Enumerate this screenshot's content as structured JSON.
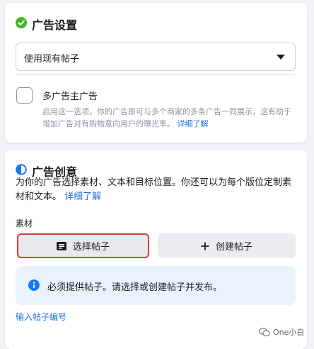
{
  "ad_settings": {
    "title": "广告设置",
    "status_icon": "check-circle-icon",
    "status_color": "#42b72a",
    "dropdown_value": "使用现有帖子",
    "multi_advertiser_label": "多广告主广告",
    "multi_advertiser_desc": "启用这一选项，你的广告即可与多个商家的多条广告一同展示，这有助于增加广告对有购物意向用户的曝光率。",
    "learn_more": "详细了解"
  },
  "ad_creative": {
    "title": "广告创意",
    "description": "为你的广告选择素材、文本和目标位置。你还可以为每个版位定制素材和文本。",
    "learn_more": "详细了解",
    "media_label": "素材",
    "select_post_label": "选择帖子",
    "create_post_label": "创建帖子",
    "info_text": "必须提供帖子。请选择或创建帖子并发布。",
    "enter_post_id": "输入帖子编号"
  },
  "watermark": "One小白",
  "colors": {
    "accent": "#216fdb",
    "highlight_border": "#e0383e",
    "info_bg": "#eaf3fd"
  }
}
